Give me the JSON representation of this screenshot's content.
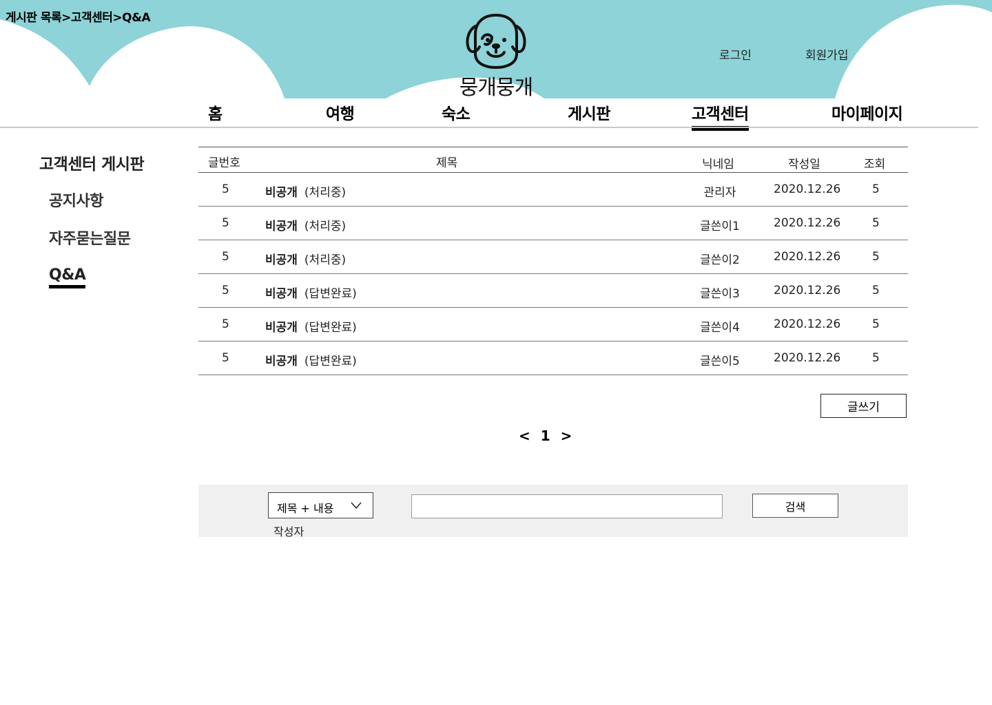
{
  "colors": {
    "header_teal": "#8DD3D7",
    "text": "#000000",
    "search_bg": "#F0F0F0"
  },
  "breadcrumb": "게시판 목록>고객센터>Q&A",
  "logo": {
    "text": "뭉개뭉개",
    "icon": "dog-face-icon"
  },
  "auth": {
    "login": "로그인",
    "signup": "회원가입"
  },
  "nav": {
    "items": [
      {
        "label": "홈"
      },
      {
        "label": "여행"
      },
      {
        "label": "숙소"
      },
      {
        "label": "게시판"
      },
      {
        "label": "고객센터"
      },
      {
        "label": "마이페이지"
      }
    ],
    "active": "고객센터"
  },
  "sidebar": {
    "title": "고객센터 게시판",
    "items": [
      {
        "label": "공지사항"
      },
      {
        "label": "자주묻는질문"
      },
      {
        "label": "Q&A"
      }
    ],
    "active": "Q&A"
  },
  "table": {
    "headers": {
      "no": "글번호",
      "title": "제목",
      "nickname": "닉네임",
      "date": "작성일",
      "views": "조회"
    },
    "rows": [
      {
        "no": "5",
        "title": "비공개",
        "status": "(처리중)",
        "nickname": "관리자",
        "date": "2020.12.26",
        "views": "5"
      },
      {
        "no": "5",
        "title": "비공개",
        "status": "(처리중)",
        "nickname": "글쓴이1",
        "date": "2020.12.26",
        "views": "5"
      },
      {
        "no": "5",
        "title": "비공개",
        "status": "(처리중)",
        "nickname": "글쓴이2",
        "date": "2020.12.26",
        "views": "5"
      },
      {
        "no": "5",
        "title": "비공개",
        "status": "(답변완료)",
        "nickname": "글쓴이3",
        "date": "2020.12.26",
        "views": "5"
      },
      {
        "no": "5",
        "title": "비공개",
        "status": "(답변완료)",
        "nickname": "글쓴이4",
        "date": "2020.12.26",
        "views": "5"
      },
      {
        "no": "5",
        "title": "비공개",
        "status": "(답변완료)",
        "nickname": "글쓴이5",
        "date": "2020.12.26",
        "views": "5"
      }
    ]
  },
  "write_button": "글쓰기",
  "pagination": {
    "prev": "<",
    "current": "1",
    "next": ">"
  },
  "search": {
    "select_value": "제목 + 내용",
    "select_options": [
      "작성자"
    ],
    "input_value": "",
    "button": "검색"
  }
}
